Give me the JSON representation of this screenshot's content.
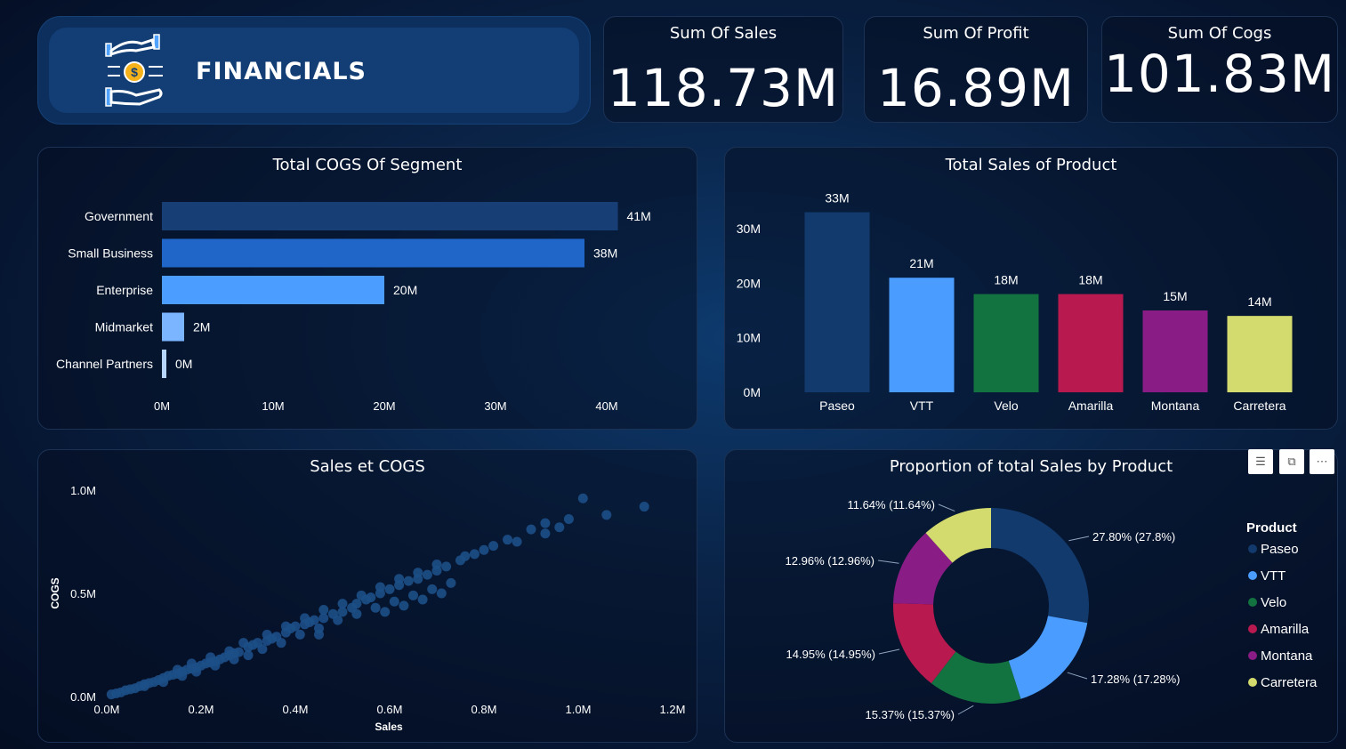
{
  "header": {
    "title": "FINANCIALS"
  },
  "kpis": [
    {
      "label": "Sum Of Sales",
      "value": "118.73M"
    },
    {
      "label": "Sum Of Profit",
      "value": "16.89M"
    },
    {
      "label": "Sum Of Cogs",
      "value": "101.83M"
    }
  ],
  "colors": {
    "Paseo": "#123a6c",
    "VTT": "#4a9cff",
    "Velo": "#137340",
    "Amarilla": "#b8194f",
    "Montana": "#8a1c86",
    "Carretera": "#d4db6e",
    "bar_gov": "#183f75",
    "bar_small": "#1f66c8",
    "bar_ent": "#4b9eff",
    "bar_mid": "#7cb5ff",
    "bar_chan": "#b6d6ff",
    "scatter": "#1d4f87"
  },
  "icons": [
    "money-hands-icon",
    "filter-icon",
    "focus-mode-icon",
    "more-options-icon"
  ],
  "chart_data": [
    {
      "type": "bar",
      "orientation": "horizontal",
      "title": "Total COGS Of Segment",
      "categories": [
        "Government",
        "Small Business",
        "Enterprise",
        "Midmarket",
        "Channel Partners"
      ],
      "values": [
        41,
        38,
        20,
        2,
        0.4
      ],
      "data_labels": [
        "41M",
        "38M",
        "20M",
        "2M",
        "0M"
      ],
      "ticks": [
        "0M",
        "10M",
        "20M",
        "30M",
        "40M"
      ],
      "xlim": [
        0,
        40
      ],
      "unit": "M"
    },
    {
      "type": "bar",
      "title": "Total Sales of Product",
      "categories": [
        "Paseo",
        "VTT",
        "Velo",
        "Amarilla",
        "Montana",
        "Carretera"
      ],
      "values": [
        33,
        21,
        18,
        18,
        15,
        14
      ],
      "data_labels": [
        "33M",
        "21M",
        "18M",
        "18M",
        "15M",
        "14M"
      ],
      "ticks": [
        "0M",
        "10M",
        "20M",
        "30M"
      ],
      "ylim": [
        0,
        30
      ],
      "unit": "M"
    },
    {
      "type": "scatter",
      "title": "Sales et COGS",
      "xlabel": "Sales",
      "ylabel": "COGS",
      "x_ticks": [
        "0.0M",
        "0.2M",
        "0.4M",
        "0.6M",
        "0.8M",
        "1.0M",
        "1.2M"
      ],
      "y_ticks": [
        "0.0M",
        "0.5M",
        "1.0M"
      ],
      "xlim": [
        0,
        1.2
      ],
      "ylim": [
        0,
        1.0
      ],
      "points": [
        [
          0.01,
          0.01
        ],
        [
          0.02,
          0.015
        ],
        [
          0.03,
          0.02
        ],
        [
          0.04,
          0.03
        ],
        [
          0.05,
          0.035
        ],
        [
          0.06,
          0.04
        ],
        [
          0.07,
          0.05
        ],
        [
          0.08,
          0.06
        ],
        [
          0.09,
          0.065
        ],
        [
          0.1,
          0.07
        ],
        [
          0.11,
          0.08
        ],
        [
          0.12,
          0.09
        ],
        [
          0.13,
          0.1
        ],
        [
          0.14,
          0.105
        ],
        [
          0.15,
          0.11
        ],
        [
          0.16,
          0.12
        ],
        [
          0.17,
          0.13
        ],
        [
          0.18,
          0.135
        ],
        [
          0.19,
          0.14
        ],
        [
          0.2,
          0.15
        ],
        [
          0.21,
          0.16
        ],
        [
          0.22,
          0.165
        ],
        [
          0.23,
          0.17
        ],
        [
          0.24,
          0.18
        ],
        [
          0.25,
          0.19
        ],
        [
          0.26,
          0.2
        ],
        [
          0.27,
          0.21
        ],
        [
          0.28,
          0.215
        ],
        [
          0.3,
          0.24
        ],
        [
          0.31,
          0.25
        ],
        [
          0.32,
          0.26
        ],
        [
          0.34,
          0.27
        ],
        [
          0.35,
          0.28
        ],
        [
          0.36,
          0.29
        ],
        [
          0.38,
          0.31
        ],
        [
          0.39,
          0.33
        ],
        [
          0.4,
          0.34
        ],
        [
          0.42,
          0.35
        ],
        [
          0.43,
          0.36
        ],
        [
          0.44,
          0.37
        ],
        [
          0.46,
          0.38
        ],
        [
          0.48,
          0.4
        ],
        [
          0.5,
          0.41
        ],
        [
          0.52,
          0.43
        ],
        [
          0.53,
          0.45
        ],
        [
          0.55,
          0.47
        ],
        [
          0.56,
          0.48
        ],
        [
          0.58,
          0.5
        ],
        [
          0.6,
          0.52
        ],
        [
          0.62,
          0.54
        ],
        [
          0.64,
          0.56
        ],
        [
          0.66,
          0.57
        ],
        [
          0.68,
          0.59
        ],
        [
          0.7,
          0.61
        ],
        [
          0.72,
          0.63
        ],
        [
          0.75,
          0.66
        ],
        [
          0.78,
          0.69
        ],
        [
          0.82,
          0.73
        ],
        [
          0.85,
          0.76
        ],
        [
          0.9,
          0.81
        ],
        [
          0.93,
          0.79
        ],
        [
          0.96,
          0.82
        ],
        [
          1.01,
          0.96
        ],
        [
          1.06,
          0.88
        ],
        [
          1.14,
          0.92
        ],
        [
          0.08,
          0.05
        ],
        [
          0.12,
          0.07
        ],
        [
          0.16,
          0.1
        ],
        [
          0.19,
          0.12
        ],
        [
          0.23,
          0.15
        ],
        [
          0.27,
          0.18
        ],
        [
          0.3,
          0.2
        ],
        [
          0.33,
          0.23
        ],
        [
          0.37,
          0.26
        ],
        [
          0.41,
          0.3
        ],
        [
          0.45,
          0.33
        ],
        [
          0.49,
          0.37
        ],
        [
          0.53,
          0.4
        ],
        [
          0.57,
          0.43
        ],
        [
          0.61,
          0.46
        ],
        [
          0.65,
          0.49
        ],
        [
          0.69,
          0.52
        ],
        [
          0.73,
          0.55
        ],
        [
          0.34,
          0.3
        ],
        [
          0.38,
          0.34
        ],
        [
          0.42,
          0.38
        ],
        [
          0.46,
          0.42
        ],
        [
          0.5,
          0.45
        ],
        [
          0.54,
          0.49
        ],
        [
          0.58,
          0.53
        ],
        [
          0.62,
          0.57
        ],
        [
          0.66,
          0.6
        ],
        [
          0.7,
          0.64
        ],
        [
          0.15,
          0.13
        ],
        [
          0.18,
          0.16
        ],
        [
          0.22,
          0.19
        ],
        [
          0.26,
          0.22
        ],
        [
          0.29,
          0.26
        ],
        [
          0.45,
          0.3
        ],
        [
          0.59,
          0.41
        ],
        [
          0.63,
          0.44
        ],
        [
          0.67,
          0.47
        ],
        [
          0.71,
          0.5
        ],
        [
          0.76,
          0.68
        ],
        [
          0.8,
          0.71
        ],
        [
          0.87,
          0.75
        ],
        [
          0.93,
          0.84
        ],
        [
          0.98,
          0.86
        ]
      ]
    },
    {
      "type": "pie",
      "subtype": "donut",
      "title": "Proportion of total Sales by Product",
      "legend_title": "Product",
      "legend_position": "right",
      "legend": [
        "Paseo",
        "VTT",
        "Velo",
        "Amarilla",
        "Montana",
        "Carretera"
      ],
      "slices": [
        {
          "name": "Paseo",
          "value": 27.8,
          "label": "27.80% (27.8%)"
        },
        {
          "name": "VTT",
          "value": 17.28,
          "label": "17.28% (17.28%)"
        },
        {
          "name": "Velo",
          "value": 15.37,
          "label": "15.37% (15.37%)"
        },
        {
          "name": "Amarilla",
          "value": 14.95,
          "label": "14.95% (14.95%)"
        },
        {
          "name": "Montana",
          "value": 12.96,
          "label": "12.96% (12.96%)"
        },
        {
          "name": "Carretera",
          "value": 11.64,
          "label": "11.64% (11.64%)"
        }
      ]
    }
  ]
}
